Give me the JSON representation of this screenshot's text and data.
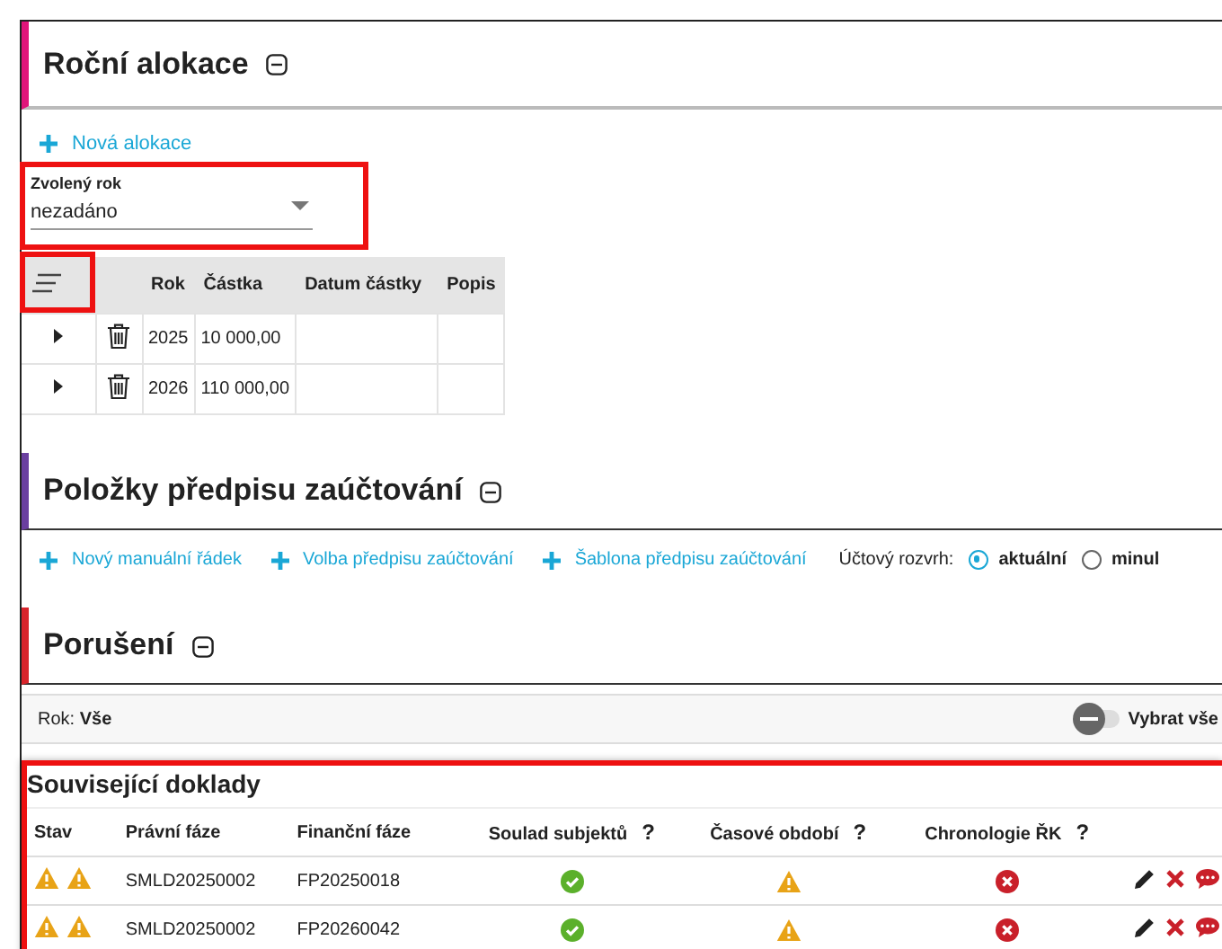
{
  "allocation": {
    "title": "Roční alokace",
    "new_link": "Nová alokace",
    "year_select": {
      "label": "Zvolený rok",
      "value": "nezadáno"
    },
    "table": {
      "columns": [
        "Rok",
        "Částka",
        "Datum částky",
        "Popis"
      ],
      "rows": [
        {
          "expanded": false,
          "cells": [
            "2025",
            "10 000,00",
            "",
            ""
          ]
        },
        {
          "expanded": false,
          "cells": [
            "2026",
            "110 000,00",
            "",
            ""
          ]
        }
      ]
    }
  },
  "posting": {
    "title": "Položky předpisu zaúčtování",
    "links": [
      "Nový manuální řádek",
      "Volba předpisu zaúčtování",
      "Šablona předpisu zaúčtování"
    ],
    "chart_label": "Účtový rozvrh:",
    "options": [
      {
        "label": "aktuální",
        "selected": true
      },
      {
        "label": "minul",
        "selected": false
      }
    ]
  },
  "violations": {
    "title": "Porušení",
    "filter_label": "Rok:",
    "filter_value": "Vše",
    "toggle": {
      "label": "Vybrat vše",
      "on": false
    }
  },
  "related": {
    "title": "Související doklady",
    "columns": [
      {
        "label": "Stav"
      },
      {
        "label": "Právní fáze"
      },
      {
        "label": "Finanční fáze"
      },
      {
        "label": "Soulad subjektů",
        "help": "?"
      },
      {
        "label": "Časové období",
        "help": "?"
      },
      {
        "label": "Chronologie ŘK",
        "help": "?"
      }
    ],
    "rows": [
      {
        "state": [
          {
            "kind": "warning"
          },
          {
            "kind": "warning"
          }
        ],
        "legal": "SMLD20250002",
        "financial": "FP20250018",
        "subjects": {
          "kind": "ok"
        },
        "period": {
          "kind": "warning"
        },
        "chronology": {
          "kind": "error"
        }
      },
      {
        "state": [
          {
            "kind": "warning"
          },
          {
            "kind": "warning"
          }
        ],
        "legal": "SMLD20250002",
        "financial": "FP20260042",
        "subjects": {
          "kind": "ok"
        },
        "period": {
          "kind": "warning"
        },
        "chronology": {
          "kind": "error"
        }
      }
    ]
  }
}
